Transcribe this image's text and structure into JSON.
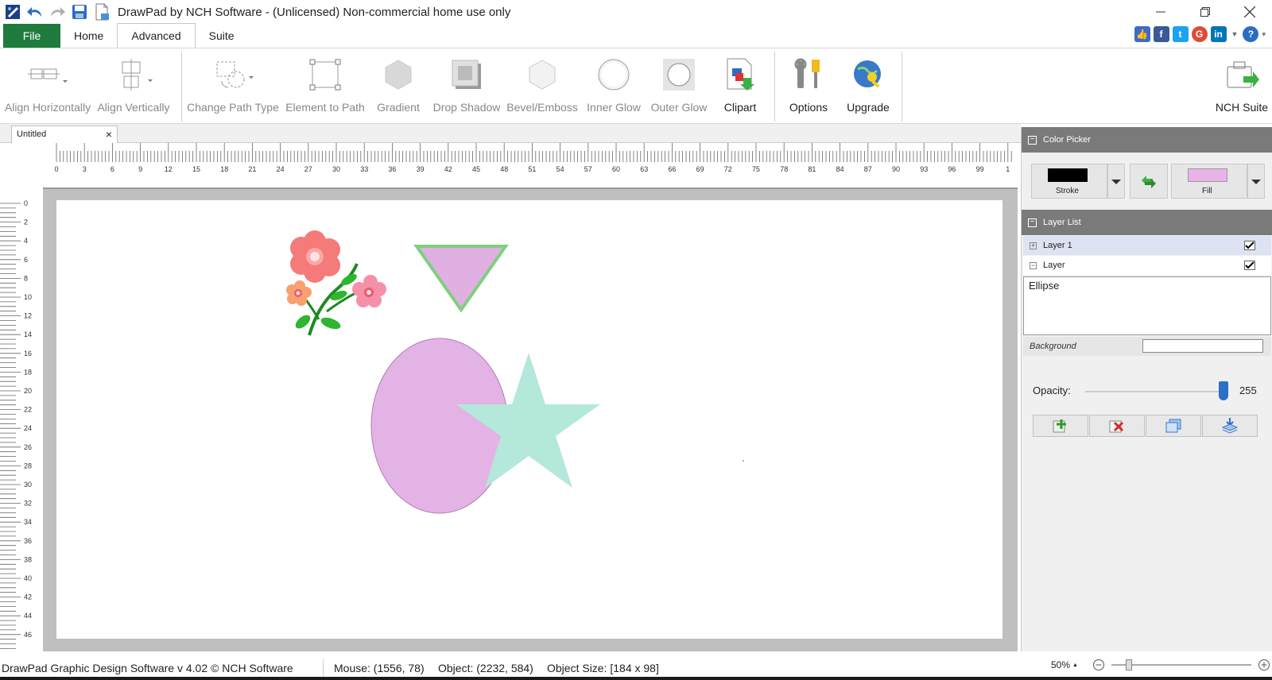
{
  "window": {
    "title": "DrawPad by NCH Software - (Unlicensed) Non-commercial home use only",
    "controls": [
      "minimize",
      "restore",
      "close"
    ]
  },
  "quick_access": [
    "app-icon",
    "undo-icon",
    "redo-icon",
    "save-icon",
    "new-icon"
  ],
  "menu_tabs": [
    {
      "label": "File"
    },
    {
      "label": "Home"
    },
    {
      "label": "Advanced"
    },
    {
      "label": "Suite"
    }
  ],
  "social": [
    "like-icon",
    "facebook-icon",
    "twitter-icon",
    "google-plus-icon",
    "linkedin-icon",
    "help-icon"
  ],
  "ribbon": {
    "align_horizontally": "Align Horizontally",
    "align_vertically": "Align Vertically",
    "change_path_type": "Change Path Type",
    "element_to_path": "Element to Path",
    "gradient": "Gradient",
    "drop_shadow": "Drop Shadow",
    "bevel_emboss": "Bevel/Emboss",
    "inner_glow": "Inner Glow",
    "outer_glow": "Outer Glow",
    "clipart": "Clipart",
    "options": "Options",
    "upgrade": "Upgrade",
    "nch_suite": "NCH Suite"
  },
  "document": {
    "tab_name": "Untitled",
    "close_glyph": "×"
  },
  "ruler": {
    "h_labels": [
      "0",
      "3",
      "6",
      "9",
      "12",
      "15",
      "18",
      "21",
      "24",
      "27",
      "30",
      "33",
      "36",
      "39",
      "42",
      "45",
      "48",
      "51",
      "54",
      "57",
      "60",
      "63",
      "66",
      "69",
      "72",
      "75",
      "78",
      "81",
      "84",
      "87",
      "90",
      "93",
      "96",
      "99",
      "1"
    ],
    "v_labels": [
      "0",
      "2",
      "4",
      "6",
      "8",
      "10",
      "12",
      "14",
      "16",
      "18",
      "20",
      "22",
      "24",
      "26",
      "28",
      "30",
      "32",
      "34",
      "36",
      "38",
      "40",
      "42",
      "44",
      "46"
    ]
  },
  "canvas": {
    "colors": {
      "ellipse_fill": "#e3b3e5",
      "ellipse_stroke": "#b07cb3",
      "star_fill": "#b4e8da",
      "triangle_fill": "#e0b0e2",
      "triangle_stroke": "#7fcf7f"
    }
  },
  "color_picker": {
    "header": "Color Picker",
    "stroke_label": "Stroke",
    "fill_label": "Fill",
    "stroke_color": "#000000",
    "fill_color": "#e8b4e8"
  },
  "layer_list": {
    "header": "Layer List",
    "layers": [
      {
        "name": "Layer 1",
        "visible": true,
        "expanded": false
      },
      {
        "name": "Layer",
        "visible": true,
        "expanded": true
      }
    ],
    "selected_element": "Ellipse",
    "background_label": "Background",
    "opacity_label": "Opacity:",
    "opacity_value": "255",
    "opacity_fraction": 1.0
  },
  "status": {
    "product": "DrawPad Graphic Design Software v 4.02 © NCH Software",
    "mouse": "Mouse: (1556, 78)",
    "object": "Object: (2232, 584)",
    "object_size": "Object Size: [184 x 98]",
    "zoom": "50%"
  }
}
